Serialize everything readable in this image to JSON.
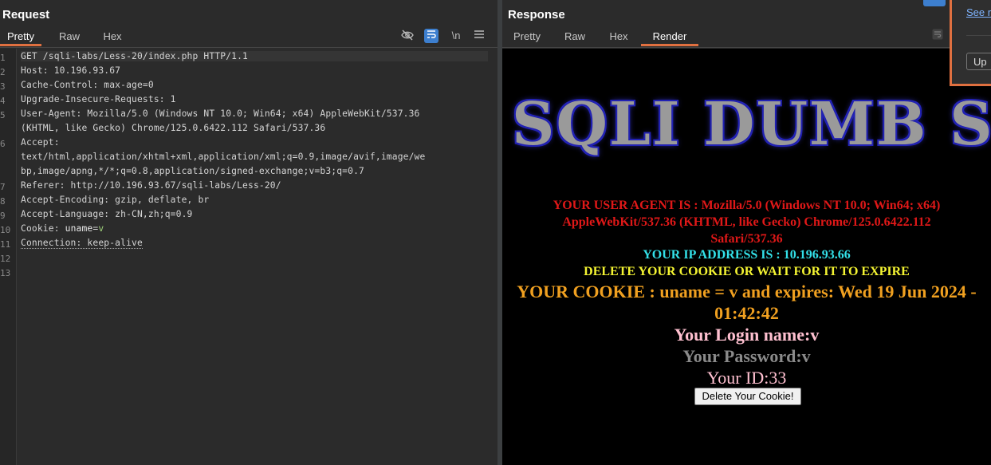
{
  "request": {
    "title": "Request",
    "tabs": [
      "Pretty",
      "Raw",
      "Hex"
    ],
    "active_tab": "Pretty",
    "toolbar": {
      "newline_label": "\\n",
      "menu_icon": "hamburger-icon",
      "hide_icon": "eye-off-icon",
      "wrap_icon": "wrap-icon"
    },
    "line_numbers": [
      "1",
      "2",
      "3",
      "4",
      "5",
      "",
      "6",
      "",
      "",
      "7",
      "8",
      "9",
      "10",
      "11",
      "12",
      "13"
    ],
    "lines": [
      "GET /sqli-labs/Less-20/index.php HTTP/1.1",
      "Host: 10.196.93.67",
      "Cache-Control: max-age=0",
      "Upgrade-Insecure-Requests: 1",
      "User-Agent: Mozilla/5.0 (Windows NT 10.0; Win64; x64) AppleWebKit/537.36",
      "(KHTML, like Gecko) Chrome/125.0.6422.112 Safari/537.36",
      "Accept:",
      "text/html,application/xhtml+xml,application/xml;q=0.9,image/avif,image/we",
      "bp,image/apng,*/*;q=0.8,application/signed-exchange;v=b3;q=0.7",
      "Referer: http://10.196.93.67/sqli-labs/Less-20/",
      "Accept-Encoding: gzip, deflate, br",
      "Accept-Language: zh-CN,zh;q=0.9",
      "",
      "",
      ""
    ],
    "cookie_key": "Cookie: ",
    "cookie_name": "uname",
    "cookie_eq": "=",
    "cookie_value": "v",
    "connection_line": "Connection: keep-alive"
  },
  "response": {
    "title": "Response",
    "tabs": [
      "Pretty",
      "Raw",
      "Hex",
      "Render"
    ],
    "active_tab": "Render",
    "render": {
      "banner": "SQLI DUMB S",
      "user_agent": "YOUR USER AGENT IS : Mozilla/5.0 (Windows NT 10.0; Win64; x64) AppleWebKit/537.36 (KHTML, like Gecko) Chrome/125.0.6422.112 Safari/537.36",
      "ip": "YOUR IP ADDRESS IS : 10.196.93.66",
      "delete_notice": "DELETE YOUR COOKIE OR WAIT FOR IT TO EXPIRE",
      "cookie": "YOUR COOKIE : uname = v and expires: Wed 19 Jun 2024 - 01:42:42",
      "login_name": "Your Login name:v",
      "password": "Your Password:v",
      "id": "Your ID:33",
      "delete_button": "Delete Your Cookie!"
    }
  },
  "popup": {
    "link": "See r",
    "button": "Up"
  },
  "colors": {
    "accent": "#e07040",
    "toggle_on": "#3d7fcf"
  }
}
